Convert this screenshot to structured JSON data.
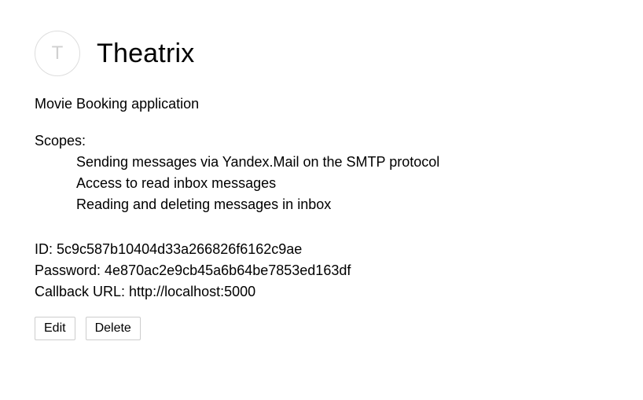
{
  "app": {
    "avatar_letter": "T",
    "title": "Theatrix",
    "description": "Movie Booking application"
  },
  "scopes": {
    "label": "Scopes:",
    "items": [
      "Sending messages via Yandex.Mail on the SMTP protocol",
      "Access to read inbox messages",
      "Reading and deleting messages in inbox"
    ]
  },
  "credentials": {
    "id_line": "ID: 5c9c587b10404d33a266826f6162c9ae",
    "password_line": "Password: 4e870ac2e9cb45a6b64be7853ed163df",
    "callback_line": "Callback URL: http://localhost:5000"
  },
  "actions": {
    "edit_label": "Edit",
    "delete_label": "Delete"
  }
}
